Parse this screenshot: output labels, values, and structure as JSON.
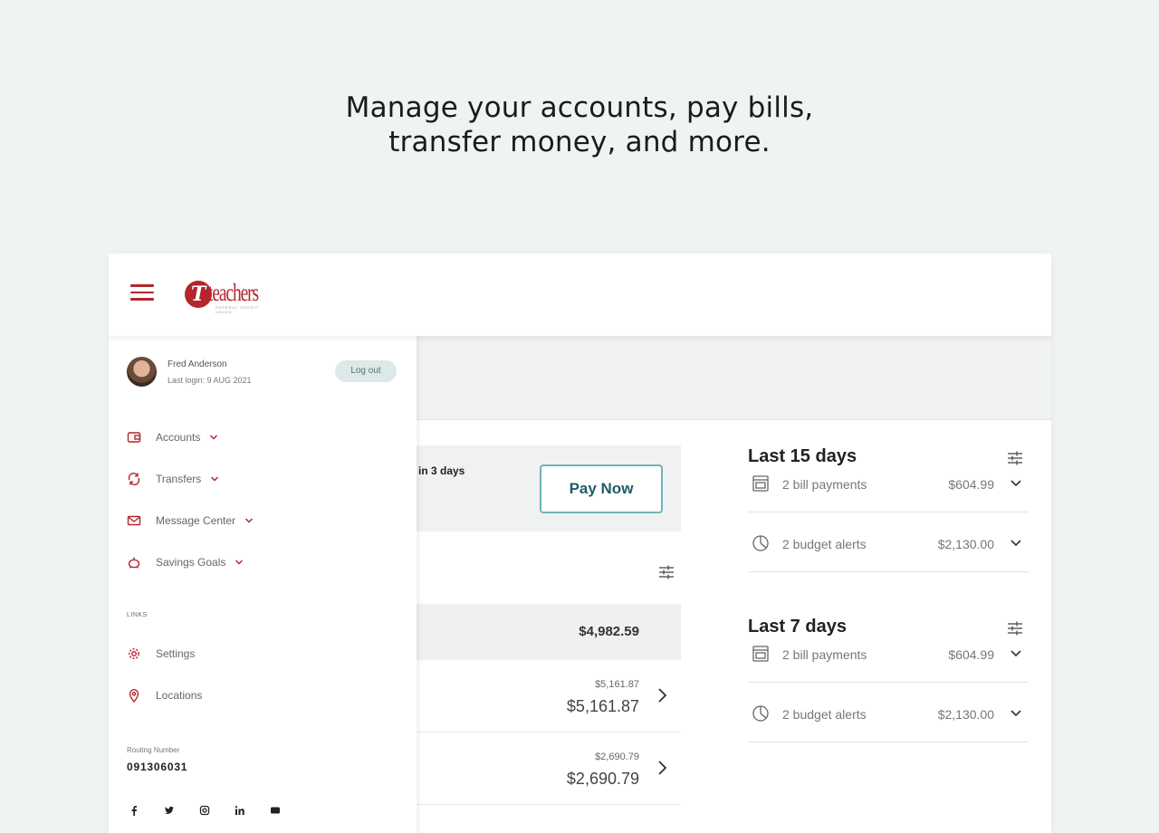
{
  "headline": {
    "line1": "Manage your accounts, pay bills,",
    "line2": "transfer money, and more."
  },
  "brand": {
    "logo_letter": "T",
    "logo_word": "teachers",
    "logo_sub": "FEDERAL CREDIT UNION",
    "accent": "#b3262c",
    "teal": "#6fb5b6"
  },
  "user": {
    "name": "Fred Anderson",
    "last_login": "Last login: 9 AUG 2021",
    "logout_label": "Log out"
  },
  "nav": {
    "items": [
      {
        "label": "Accounts",
        "icon": "accounts-icon"
      },
      {
        "label": "Transfers",
        "icon": "transfers-icon"
      },
      {
        "label": "Message Center",
        "icon": "mail-icon"
      },
      {
        "label": "Savings Goals",
        "icon": "piggy-bank-icon"
      }
    ],
    "links_header": "LINKS",
    "links": [
      {
        "label": "Settings",
        "icon": "gear-icon"
      },
      {
        "label": "Locations",
        "icon": "location-pin-icon"
      }
    ],
    "routing_label": "Routing Number",
    "routing_number": "091306031"
  },
  "bill": {
    "due_text": "in 3 days",
    "pay_now_label": "Pay Now"
  },
  "accounts": {
    "total": "$4,982.59",
    "rows": [
      {
        "available": "$5,161.87",
        "balance": "$5,161.87"
      },
      {
        "available": "$2,690.79",
        "balance": "$2,690.79"
      }
    ]
  },
  "activity": {
    "sections": [
      {
        "title": "Last 15 days",
        "rows": [
          {
            "label": "2 bill payments",
            "amount": "$604.99",
            "icon": "bill-icon"
          },
          {
            "label": "2 budget alerts",
            "amount": "$2,130.00",
            "icon": "pie-chart-icon"
          }
        ]
      },
      {
        "title": "Last 7 days",
        "rows": [
          {
            "label": "2 bill payments",
            "amount": "$604.99",
            "icon": "bill-icon"
          },
          {
            "label": "2 budget alerts",
            "amount": "$2,130.00",
            "icon": "pie-chart-icon"
          }
        ]
      }
    ]
  }
}
